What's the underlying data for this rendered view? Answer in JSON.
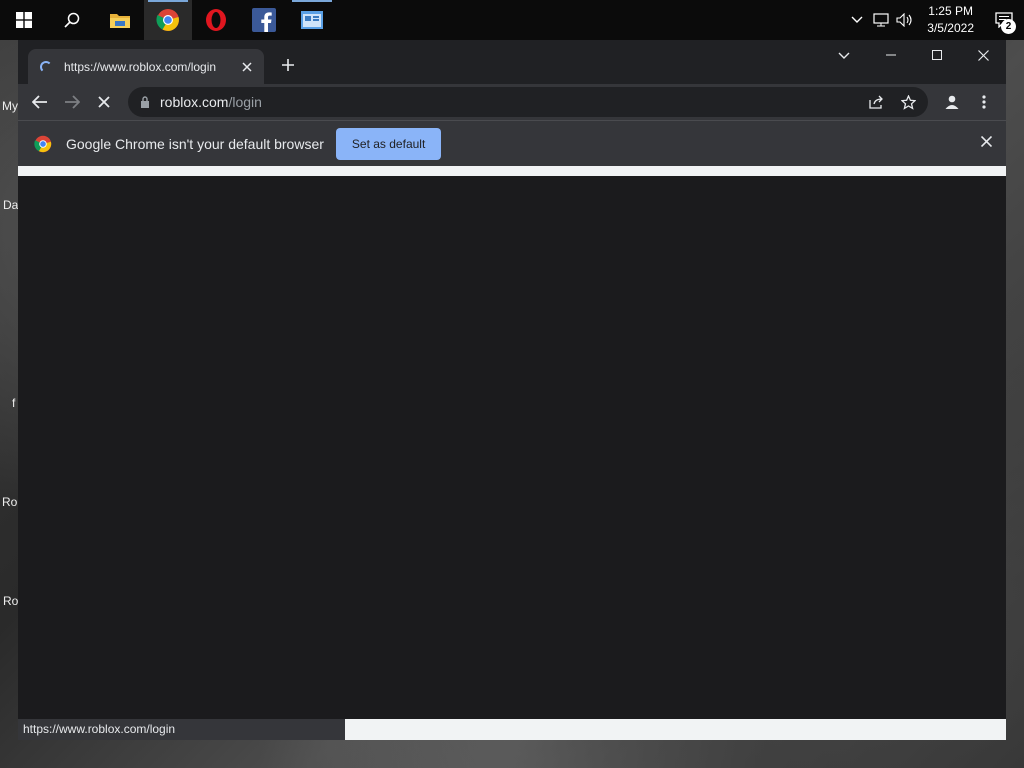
{
  "taskbar": {
    "apps": [
      {
        "name": "windows-start"
      },
      {
        "name": "search"
      },
      {
        "name": "file-explorer"
      },
      {
        "name": "chrome"
      },
      {
        "name": "opera"
      },
      {
        "name": "facebook"
      },
      {
        "name": "app-window"
      }
    ],
    "time": "1:25 PM",
    "date": "3/5/2022",
    "notification_count": "2"
  },
  "desktop_labels": {
    "a": "My",
    "b": "Da",
    "c": "f",
    "d": "Rol",
    "e": "Ro"
  },
  "browser": {
    "tab_title": "https://www.roblox.com/login",
    "url_host": "roblox.com",
    "url_path": "/login",
    "infobar_text": "Google Chrome isn't your default browser",
    "infobar_button": "Set as default",
    "status_url": "https://www.roblox.com/login"
  },
  "colors": {
    "accent": "#8ab4f8",
    "chrome_dark": "#202124",
    "chrome_toolbar": "#35363a"
  }
}
